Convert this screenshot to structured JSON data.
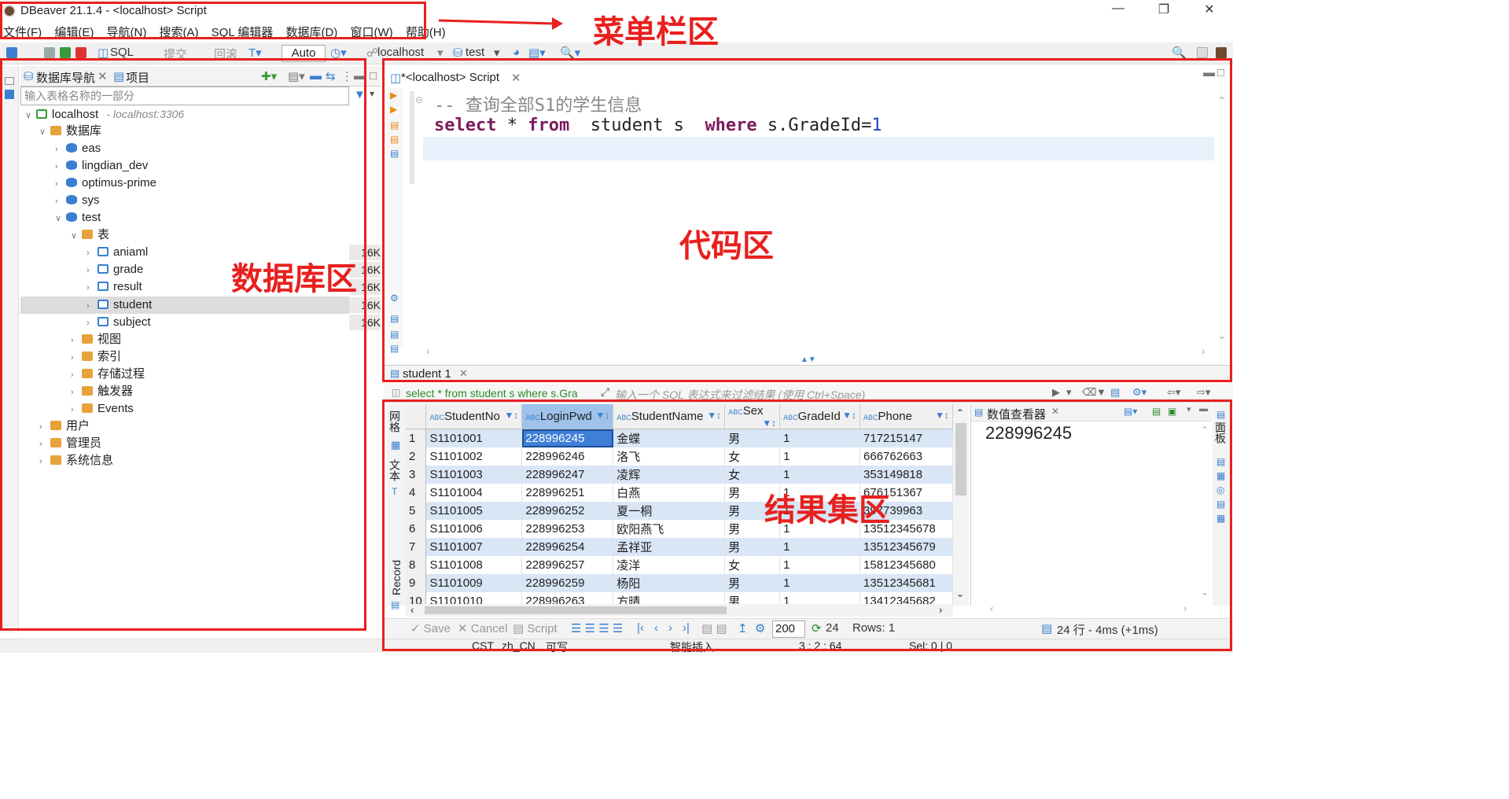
{
  "window": {
    "title": "DBeaver 21.1.4 - <localhost> Script"
  },
  "menu": [
    "文件(F)",
    "编辑(E)",
    "导航(N)",
    "搜索(A)",
    "SQL 编辑器",
    "数据库(D)",
    "窗口(W)",
    "帮助(H)"
  ],
  "toolbar": {
    "sql": "SQL",
    "commit": "提交",
    "rollback": "回滚",
    "auto": "Auto",
    "connection": "localhost",
    "schema": "test"
  },
  "annotations": {
    "menu_area": "菜单栏区",
    "db_area": "数据库区",
    "code_area": "代码区",
    "result_area": "结果集区"
  },
  "navigator": {
    "tab_db": "数据库导航",
    "tab_project": "项目",
    "filter_placeholder": "输入表格名称的一部分",
    "host": "localhost",
    "host_addr": "- localhost:3306",
    "databases_label": "数据库",
    "databases": [
      "eas",
      "lingdian_dev",
      "optimus-prime",
      "sys",
      "test"
    ],
    "tables_label": "表",
    "tables": [
      {
        "name": "aniaml",
        "size": "16K"
      },
      {
        "name": "grade",
        "size": "16K"
      },
      {
        "name": "result",
        "size": "16K"
      },
      {
        "name": "student",
        "size": "16K"
      },
      {
        "name": "subject",
        "size": "16K"
      }
    ],
    "folders": [
      "视图",
      "索引",
      "存储过程",
      "触发器",
      "Events"
    ],
    "root_items": [
      "用户",
      "管理员",
      "系统信息"
    ]
  },
  "editor": {
    "tab": "*<localhost> Script",
    "comment": "-- 查询全部S1的学生信息",
    "kw_select": "select",
    "star": "*",
    "kw_from": "from",
    "table_alias": "student s",
    "kw_where": "where",
    "cond": "s.GradeId=",
    "cond_val": "1"
  },
  "results": {
    "tab": "student 1",
    "query": "select * from student s where s.Gra",
    "filter_placeholder": "输入一个 SQL 表达式来过滤结果 (使用 Ctrl+Space)",
    "side_grid": "网格",
    "side_text": "文本",
    "side_record": "Record",
    "columns": [
      "StudentNo",
      "LoginPwd",
      "StudentName",
      "Sex",
      "GradeId",
      "Phone"
    ],
    "rows": [
      [
        "1",
        "S1101001",
        "228996245",
        "金蝶",
        "男",
        "1",
        "717215147"
      ],
      [
        "2",
        "S1101002",
        "228996246",
        "洛飞",
        "女",
        "1",
        "666762663"
      ],
      [
        "3",
        "S1101003",
        "228996247",
        "凌辉",
        "女",
        "1",
        "353149818"
      ],
      [
        "4",
        "S1101004",
        "228996251",
        "白燕",
        "男",
        "1",
        "676151367"
      ],
      [
        "5",
        "S1101005",
        "228996252",
        "夏一桐",
        "男",
        "1",
        "397739963"
      ],
      [
        "6",
        "S1101006",
        "228996253",
        "欧阳燕飞",
        "男",
        "1",
        "13512345678"
      ],
      [
        "7",
        "S1101007",
        "228996254",
        "孟祥亚",
        "男",
        "1",
        "13512345679"
      ],
      [
        "8",
        "S1101008",
        "228996257",
        "凌洋",
        "女",
        "1",
        "15812345680"
      ],
      [
        "9",
        "S1101009",
        "228996259",
        "杨阳",
        "男",
        "1",
        "13512345681"
      ],
      [
        "10",
        "S1101010",
        "228996263",
        "方晴",
        "男",
        "1",
        "13412345682"
      ]
    ],
    "value_viewer_title": "数值查看器",
    "value_viewer_value": "228996245",
    "panel_side": "面板"
  },
  "status": {
    "save": "Save",
    "cancel": "Cancel",
    "script": "Script",
    "fetch_size": "200",
    "refresh_count": "24",
    "rows": "Rows: 1",
    "summary": "24 行 - 4ms (+1ms)"
  },
  "bottom": {
    "tz": "CST",
    "locale": "zh_CN",
    "mode": "可写",
    "insert": "智能插入",
    "pos": "3 : 2 : 64",
    "sel": "Sel: 0 | 0"
  },
  "colors": {
    "annotation": "#e8201e",
    "keyword": "#7a1b5e",
    "number": "#1f3fc4",
    "row_stripe": "#d9e6f5",
    "selection": "#3f7fd6"
  }
}
